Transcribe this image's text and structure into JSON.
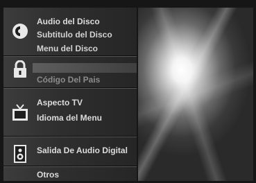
{
  "menu": {
    "disc_group": {
      "icon": "disc-icon",
      "items": [
        "Audio del Disco",
        "Subtitulo del Disco",
        "Menu del Disco"
      ]
    },
    "lock_group": {
      "icon": "padlock-icon",
      "items": [
        "Código Del Pais"
      ]
    },
    "tv_group": {
      "icon": "tv-icon",
      "items": [
        "Aspecto TV",
        "Idioma del Menu"
      ]
    },
    "audio_group": {
      "icon": "speaker-icon",
      "items": [
        "Salida De Audio Digital"
      ]
    },
    "other_group": {
      "items": [
        "Otros"
      ]
    }
  },
  "colors": {
    "panel": "#2e2e2e",
    "text": "#dcdcdc",
    "highlight": "#5e5e5e",
    "preview_glow": "#ffffff"
  }
}
